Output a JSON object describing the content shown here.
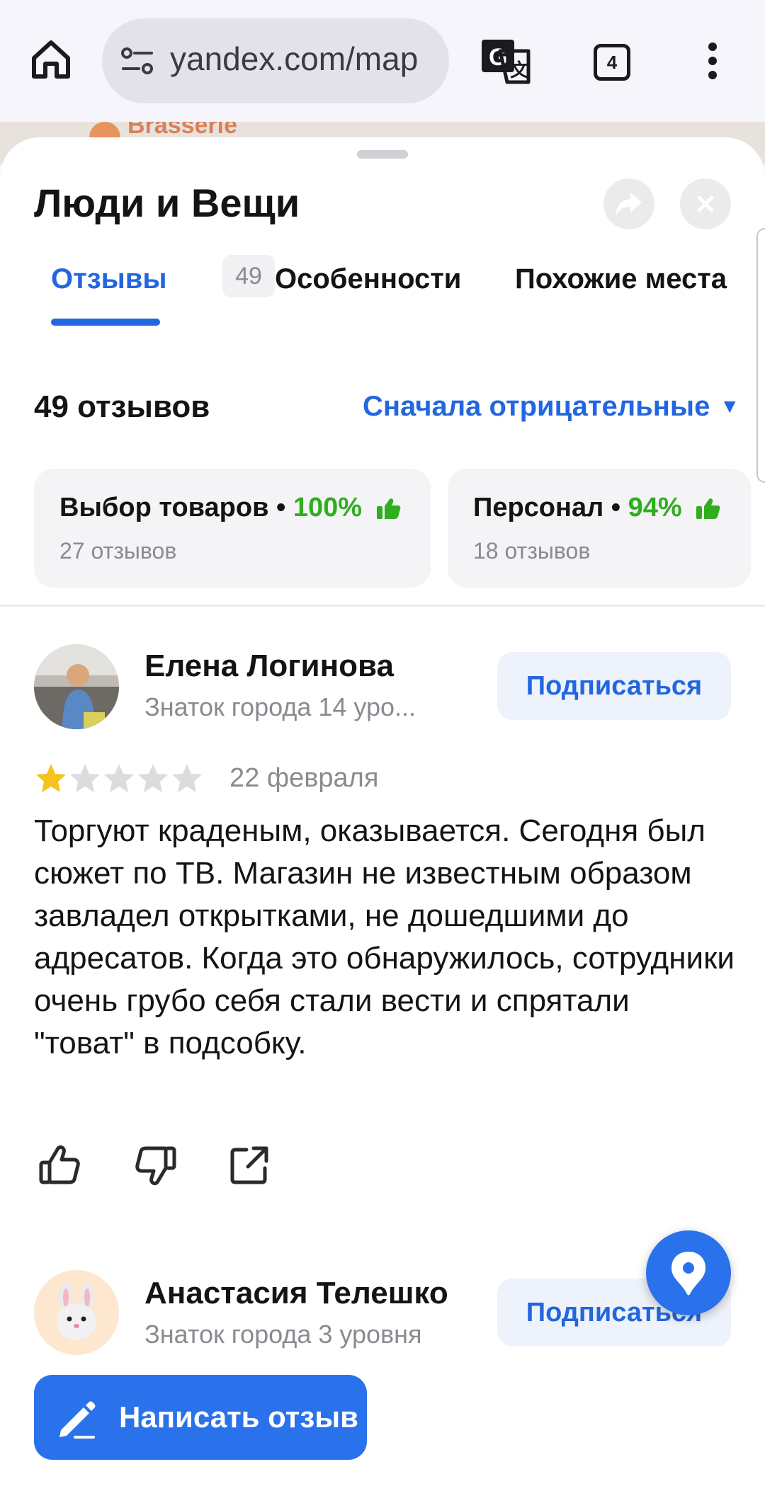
{
  "browser": {
    "url": "yandex.com/map",
    "tab_count": "4",
    "icons": [
      "home-icon",
      "site-settings-icon",
      "translate-icon",
      "more-vert-icon"
    ]
  },
  "map": {
    "peek_label": "Brasserie"
  },
  "place": {
    "title": "Люди и Вещи"
  },
  "tabs": [
    {
      "label": "Отзывы",
      "count": "49"
    },
    {
      "label": "Особенности"
    },
    {
      "label": "Похожие места"
    }
  ],
  "reviews_header": {
    "count_label": "49 отзывов",
    "sort_label": "Сначала отрицательные"
  },
  "aspects": [
    {
      "name": "Выбор товаров",
      "percent": "100%",
      "sub": "27 отзывов"
    },
    {
      "name": "Персонал",
      "percent": "94%",
      "sub": "18 отзывов"
    }
  ],
  "reviews": [
    {
      "author": "Елена Логинова",
      "level": "Знаток города 14 уро...",
      "subscribe_label": "Подписаться",
      "rating": 1,
      "date": "22 февраля",
      "text": "Торгуют краденым, оказывается. Сегодня был сюжет по ТВ. Магазин не известным образом завладел открытками, не дошедшими до адресатов. Когда это обнаружилось, сотрудники очень грубо себя стали вести и спрятали \"товат\" в подсобку."
    },
    {
      "author": "Анастасия Телешко",
      "level": "Знаток города 3 уровня",
      "subscribe_label": "Подписаться"
    }
  ],
  "write_review_label": "Написать отзыв",
  "colors": {
    "accent": "#2266e0",
    "positive": "#2fae1e",
    "star_filled": "#f6c21c",
    "star_empty": "#dcdcdf"
  }
}
